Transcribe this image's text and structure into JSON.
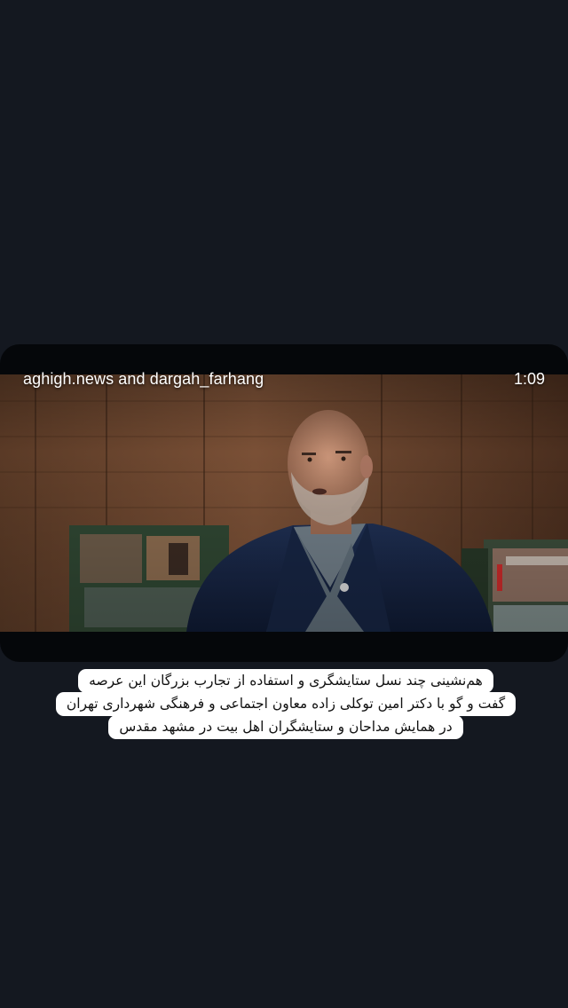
{
  "video": {
    "author": "aghigh.news and dargah_farhang",
    "duration": "1:09",
    "frame_description_icon": "interview-still"
  },
  "caption": {
    "lines": [
      "هم‌نشینی چند نسل ستایشگری و استفاده از تجارب بزرگان این عرصه",
      "گفت و گو با دکتر امین توکلی زاده معاون اجتماعی و فرهنگی شهرداری تهران",
      "در همایش مداحان و ستایشگران اهل بیت در مشهد مقدس"
    ]
  },
  "colors": {
    "page_background": "#141820",
    "video_letterbox": "#05070a",
    "caption_background": "#ffffff",
    "caption_text": "#111111"
  }
}
